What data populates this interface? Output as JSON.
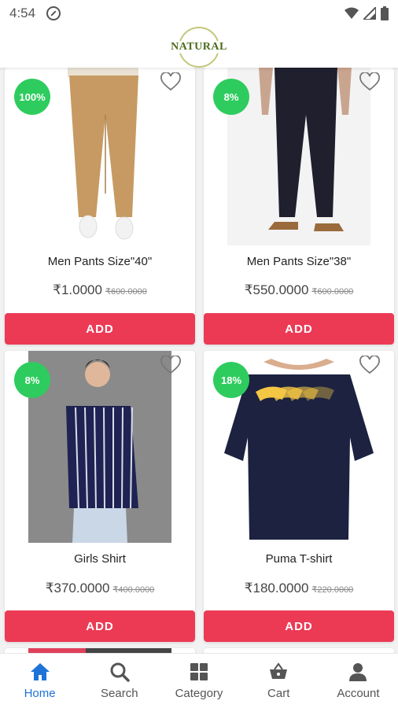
{
  "status_bar": {
    "time": "4:54"
  },
  "header": {
    "logo_text": "NATURAL"
  },
  "products": [
    {
      "name": "Men Pants Size\"40\"",
      "price": "₹1.0000",
      "mrp": "₹600.0000",
      "discount": "100%",
      "button": "ADD",
      "image": "khaki-pants"
    },
    {
      "name": "Men Pants Size\"38\"",
      "price": "₹550.0000",
      "mrp": "₹600.0000",
      "discount": "8%",
      "button": "ADD",
      "image": "navy-pants"
    },
    {
      "name": "Girls Shirt",
      "price": "₹370.0000",
      "mrp": "₹400.0000",
      "discount": "8%",
      "button": "ADD",
      "image": "striped-shirt"
    },
    {
      "name": "Puma T-shirt",
      "price": "₹180.0000",
      "mrp": "₹220.0000",
      "discount": "18%",
      "button": "ADD",
      "image": "navy-tshirt"
    }
  ],
  "bottom_nav": [
    {
      "label": "Home",
      "icon": "home-icon",
      "active": true
    },
    {
      "label": "Search",
      "icon": "search-icon",
      "active": false
    },
    {
      "label": "Category",
      "icon": "category-icon",
      "active": false
    },
    {
      "label": "Cart",
      "icon": "cart-icon",
      "active": false
    },
    {
      "label": "Account",
      "icon": "account-icon",
      "active": false
    }
  ],
  "colors": {
    "accent": "#ec3a55",
    "badge": "#2ecc5e",
    "active_nav": "#1e73d8"
  }
}
